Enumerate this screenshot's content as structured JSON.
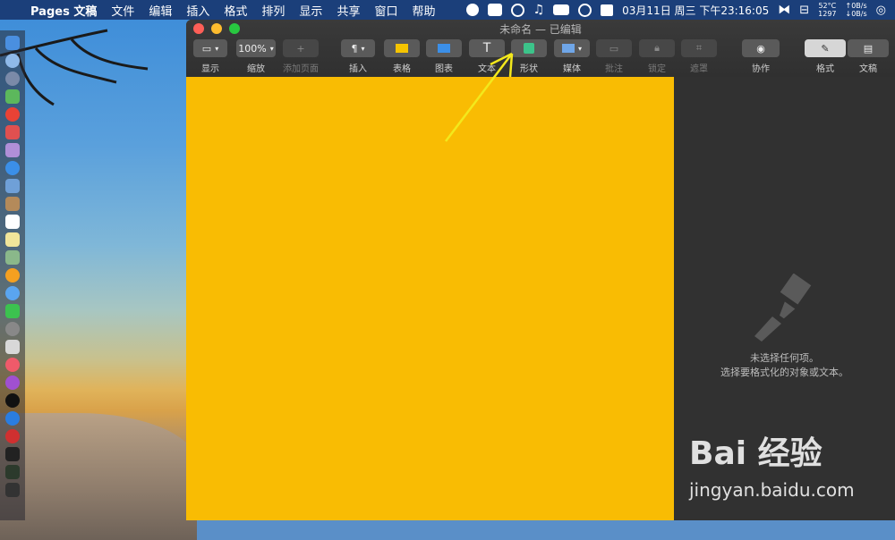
{
  "menubar": {
    "app_name": "Pages 文稿",
    "items": [
      "文件",
      "编辑",
      "插入",
      "格式",
      "排列",
      "显示",
      "共享",
      "窗口",
      "帮助"
    ],
    "datetime": "03月11日 周三 下午23:16:05",
    "temp_top": "52°C",
    "temp_bottom": "1297",
    "net_up": "↑0B/s",
    "net_down": "↓0B/s"
  },
  "window": {
    "title": "未命名 — 已编辑",
    "toolbar": {
      "view": "显示",
      "zoom_value": "100%",
      "zoom": "缩放",
      "add_page": "添加页面",
      "insert": "插入",
      "table": "表格",
      "chart": "图表",
      "text": "文本",
      "shape": "形状",
      "media": "媒体",
      "comment": "批注",
      "lock": "锁定",
      "mask": "遮罩",
      "collaborate": "协作",
      "format": "格式",
      "document": "文稿"
    },
    "inspector": {
      "line1": "未选择任何项。",
      "line2": "选择要格式化的对象或文本。"
    }
  },
  "watermark": {
    "brand": "Bai 经验",
    "url": "jingyan.baidu.com"
  },
  "colors": {
    "page": "#f9bc03",
    "arrow": "#f3e81c",
    "menubar": "#1b3f7a"
  }
}
